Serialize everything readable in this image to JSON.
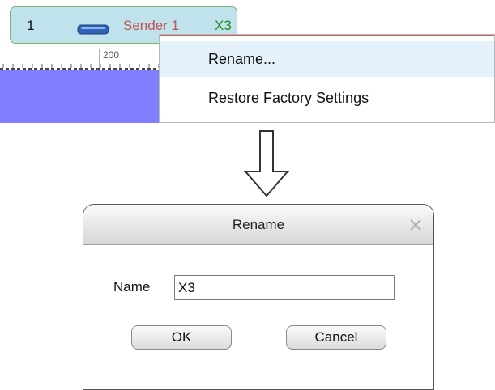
{
  "sender_tab": {
    "index": "1",
    "icon": "sender-device-icon",
    "name": "Sender 1",
    "connection": "X3",
    "colors": {
      "tab_background": "#bfe2ec",
      "name_color": "#c25050",
      "connection_color": "#1f8b1f"
    }
  },
  "ruler": {
    "label": "200"
  },
  "canvas": {
    "fill_color": "#7f7fff"
  },
  "context_menu": {
    "items": [
      {
        "label": "Rename...",
        "highlighted": true
      },
      {
        "label": "Restore Factory Settings",
        "highlighted": false
      }
    ]
  },
  "arrow": {
    "icon": "down-arrow-icon"
  },
  "rename_dialog": {
    "title": "Rename",
    "close_icon": "close-icon",
    "name_label": "Name",
    "name_value": "X3",
    "ok_label": "OK",
    "cancel_label": "Cancel"
  }
}
